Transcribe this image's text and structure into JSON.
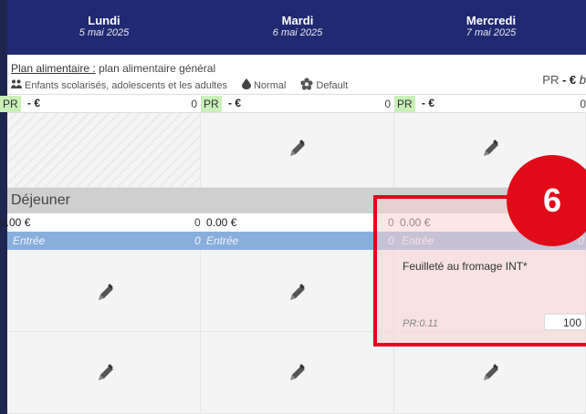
{
  "days": [
    {
      "name": "Lundi",
      "date": "5 mai 2025"
    },
    {
      "name": "Mardi",
      "date": "6 mai 2025"
    },
    {
      "name": "Mercredi",
      "date": "7 mai 2025"
    }
  ],
  "info": {
    "plan_label": "Plan alimentaire :",
    "plan_value": "plan alimentaire général",
    "audience": "Enfants scolarisés, adolescents et les adultes",
    "texture": "Normal",
    "profile": "Default",
    "pr_prefix": "PR",
    "pr_sep": "- €",
    "pr_tail": "b"
  },
  "cost_row": {
    "pr": "PR",
    "euro": "- €",
    "zero": "0"
  },
  "section": {
    "title": "Déjeuner",
    "amount": "0.00 €",
    "amount_zero": "0",
    "entree_label": "Entrée",
    "entree_zero": "0"
  },
  "highlight": {
    "badge": "6",
    "dish": "Feuilleté au fromage INT*",
    "pr": "PR:0.11",
    "quantity": "100"
  },
  "colors": {
    "header": "#1f2a72",
    "pr_badge": "#c8f0b8",
    "entree_row": "#8aaedc",
    "highlight_border": "#e8001c"
  }
}
